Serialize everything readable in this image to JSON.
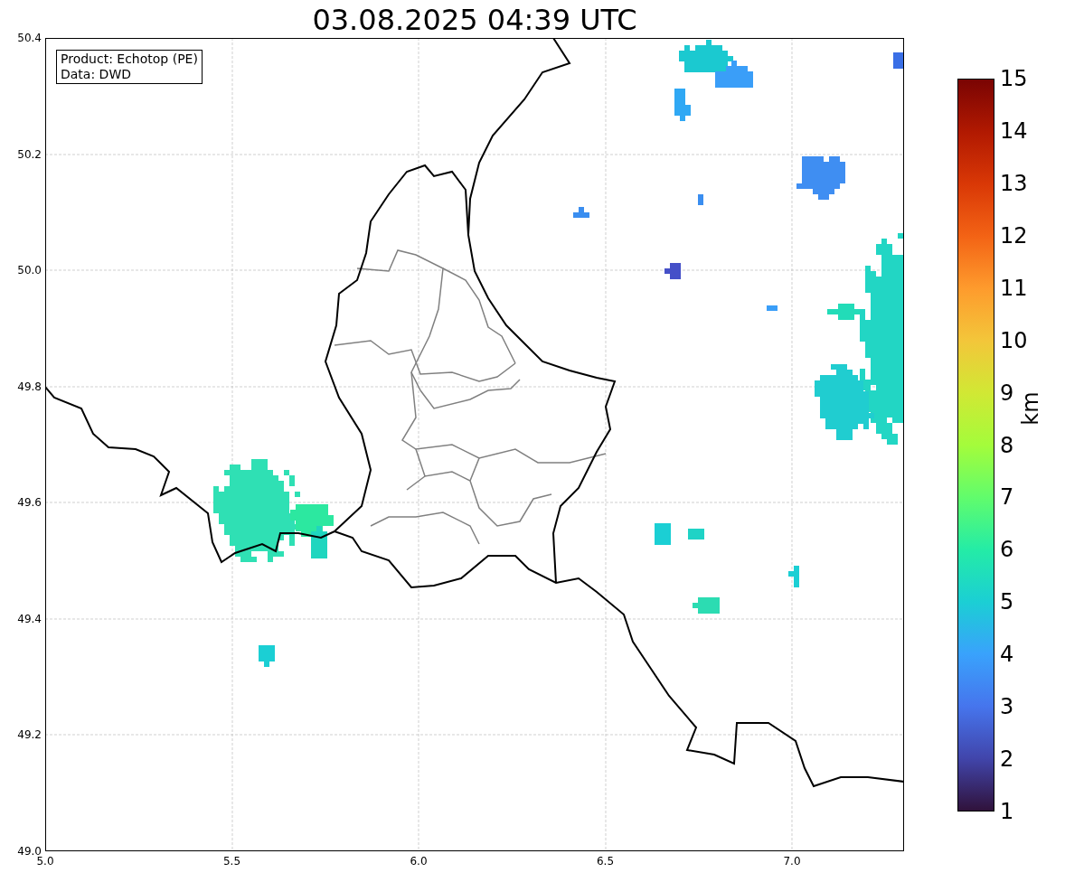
{
  "title": "03.08.2025 04:39 UTC",
  "map": {
    "info_box": [
      "Product: Echotop (PE)",
      "Data: DWD"
    ],
    "y_ticks": [
      "50.4",
      "50.2",
      "50.0",
      "49.8",
      "49.6",
      "49.4",
      "49.2",
      "49.0"
    ],
    "x_ticks": [
      "5.0",
      "5.5",
      "6.0",
      "6.5",
      "7.0"
    ]
  },
  "colorbar": {
    "ticks": [
      "15",
      "14",
      "13",
      "12",
      "11",
      "10",
      "9",
      "8",
      "7",
      "6",
      "5",
      "4",
      "3",
      "2",
      "1"
    ],
    "label": "km"
  }
}
